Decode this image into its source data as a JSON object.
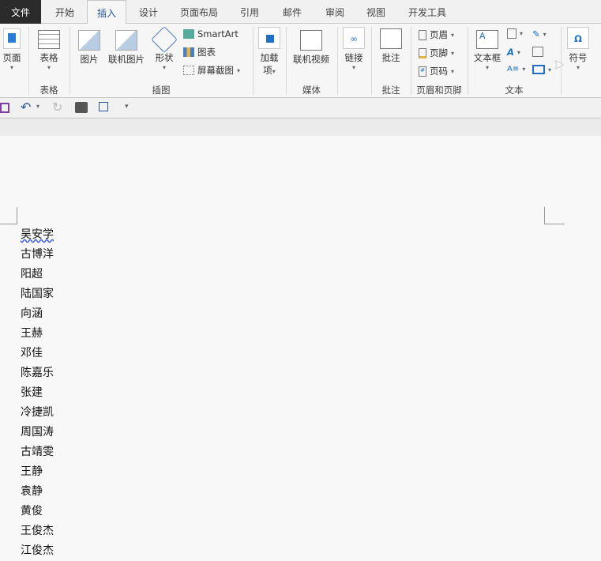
{
  "tabs": [
    "文件",
    "开始",
    "插入",
    "设计",
    "页面布局",
    "引用",
    "邮件",
    "审阅",
    "视图",
    "开发工具"
  ],
  "active_tab": "插入",
  "ribbon": {
    "page": "页面",
    "table": "表格",
    "table_group": "表格",
    "picture": "图片",
    "online_picture": "联机图片",
    "shapes": "形状",
    "smartart": "SmartArt",
    "chart": "图表",
    "screenshot": "屏幕截图",
    "illustrations_group": "插图",
    "addins": "加载",
    "addins2": "项",
    "online_video": "联机视频",
    "media_group": "媒体",
    "link": "链接",
    "comment": "批注",
    "comment_group": "批注",
    "header": "页眉",
    "footer": "页脚",
    "page_number": "页码",
    "header_footer_group": "页眉和页脚",
    "textbox": "文本框",
    "text_group": "文本",
    "symbol": "符号"
  },
  "document": {
    "lines": [
      "吴安学",
      "古博洋",
      "阳超",
      "陆国家",
      "向涵",
      "王赫",
      "邓佳",
      "陈嘉乐",
      "张建",
      "冷捷凯",
      "周国涛",
      "古靖雯",
      "王静",
      "袁静",
      "黄俊",
      "王俊杰",
      "江俊杰"
    ]
  }
}
